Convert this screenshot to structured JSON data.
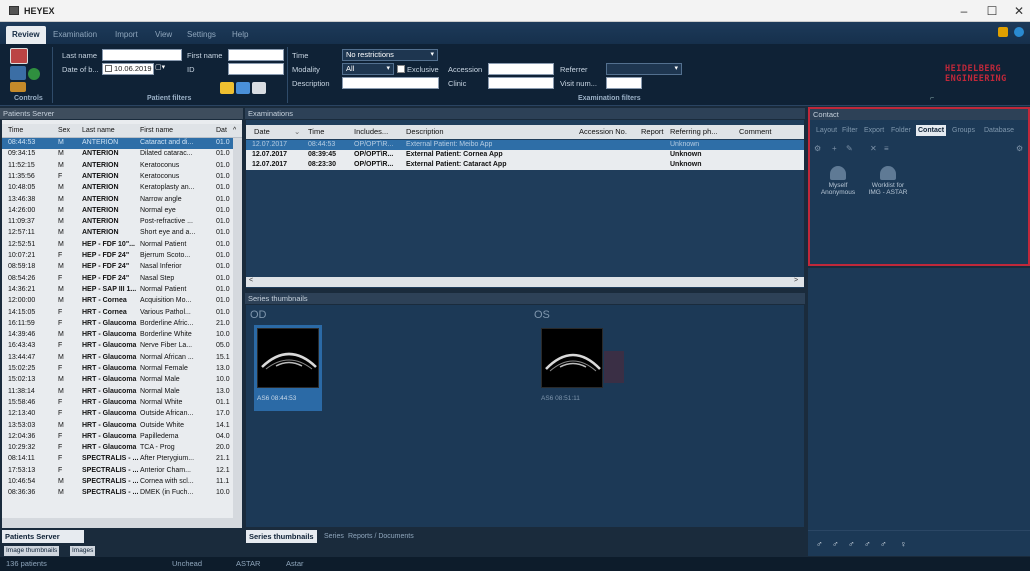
{
  "app": {
    "title": "HEYEX",
    "logo_line1": "HEIDELBERG",
    "logo_line2": "ENGINEERING",
    "status_patients": "136 patients",
    "status_user1": "Unchead",
    "status_user2": "ASTAR",
    "status_user3": "Astar"
  },
  "menu": [
    "Review",
    "Examination",
    "Import",
    "View",
    "Settings",
    "Help"
  ],
  "ribbon": {
    "controls_caption": "Controls",
    "last_name_label": "Last name",
    "first_name_label": "First name",
    "dob_label": "Date of b...",
    "dob_value": "10.06.2019",
    "id_label": "ID",
    "patient_filters_caption": "Patient filters",
    "time_label": "Time",
    "time_value": "No restrictions",
    "modality_label": "Modality",
    "modality_value": "All",
    "exclusive_label": "Exclusive",
    "description_label": "Description",
    "accession_label": "Accession",
    "clinic_label": "Clinic",
    "referrer_label": "Referrer",
    "visit_label": "Visit num...",
    "exam_filters_caption": "Examination filters"
  },
  "patients": {
    "panel_title": "Patients Server",
    "columns": [
      "Time",
      "Sex",
      "Last name",
      "First name",
      "Dat"
    ],
    "rows": [
      [
        "08:44:53",
        "M",
        "ANTERION",
        "Cataract and di...",
        "01.0"
      ],
      [
        "09:34:15",
        "M",
        "ANTERION",
        "Dilated catarac...",
        "01.0"
      ],
      [
        "11:52:15",
        "M",
        "ANTERION",
        "Keratoconus",
        "01.0"
      ],
      [
        "11:35:56",
        "F",
        "ANTERION",
        "Keratoconus",
        "01.0"
      ],
      [
        "10:48:05",
        "M",
        "ANTERION",
        "Keratoplasty an...",
        "01.0"
      ],
      [
        "13:46:38",
        "M",
        "ANTERION",
        "Narrow angle",
        "01.0"
      ],
      [
        "14:26:00",
        "M",
        "ANTERION",
        "Normal eye",
        "01.0"
      ],
      [
        "11:09:37",
        "M",
        "ANTERION",
        "Post-refractive ...",
        "01.0"
      ],
      [
        "12:57:11",
        "M",
        "ANTERION",
        "Short eye and a...",
        "01.0"
      ],
      [
        "12:52:51",
        "M",
        "HEP - FDF 10\"...",
        "Normal Patient",
        "01.0"
      ],
      [
        "10:07:21",
        "F",
        "HEP - FDF 24\"",
        "Bjerrum Scoto...",
        "01.0"
      ],
      [
        "08:59:18",
        "M",
        "HEP - FDF 24\"",
        "Nasal Inferior",
        "01.0"
      ],
      [
        "08:54:26",
        "F",
        "HEP - FDF 24\"",
        "Nasal Step",
        "01.0"
      ],
      [
        "14:36:21",
        "M",
        "HEP - SAP III 1...",
        "Normal Patient",
        "01.0"
      ],
      [
        "12:00:00",
        "M",
        "HRT - Cornea",
        "Acquisition Mo...",
        "01.0"
      ],
      [
        "14:15:05",
        "F",
        "HRT - Cornea",
        "Various Pathol...",
        "01.0"
      ],
      [
        "16:11:59",
        "F",
        "HRT - Glaucoma",
        "Borderline Afric...",
        "21.0"
      ],
      [
        "14:39:46",
        "M",
        "HRT - Glaucoma",
        "Borderline White",
        "10.0"
      ],
      [
        "16:43:43",
        "F",
        "HRT - Glaucoma",
        "Nerve Fiber La...",
        "05.0"
      ],
      [
        "13:44:47",
        "M",
        "HRT - Glaucoma",
        "Normal African ...",
        "15.1"
      ],
      [
        "15:02:25",
        "F",
        "HRT - Glaucoma",
        "Normal Female",
        "13.0"
      ],
      [
        "15:02:13",
        "M",
        "HRT - Glaucoma",
        "Normal Male",
        "10.0"
      ],
      [
        "11:38:14",
        "M",
        "HRT - Glaucoma",
        "Normal Male",
        "13.0"
      ],
      [
        "15:58:46",
        "F",
        "HRT - Glaucoma",
        "Normal White",
        "01.1"
      ],
      [
        "12:13:40",
        "F",
        "HRT - Glaucoma",
        "Outside African...",
        "17.0"
      ],
      [
        "13:53:03",
        "M",
        "HRT - Glaucoma",
        "Outside White",
        "14.1"
      ],
      [
        "12:04:36",
        "F",
        "HRT - Glaucoma",
        "Papilledema",
        "04.0"
      ],
      [
        "10:29:32",
        "F",
        "HRT - Glaucoma",
        "TCA - Prog",
        "20.0"
      ],
      [
        "08:14:11",
        "F",
        "SPECTRALIS - ...",
        "After Pterygium...",
        "21.1"
      ],
      [
        "17:53:13",
        "F",
        "SPECTRALIS - ...",
        "Anterior Cham...",
        "12.1"
      ],
      [
        "10:46:54",
        "M",
        "SPECTRALIS - ...",
        "Cornea with scl...",
        "11.1"
      ],
      [
        "08:36:36",
        "M",
        "SPECTRALIS - ...",
        "DMEK (in Fuch...",
        "10.0"
      ]
    ],
    "bottom_tab": "Patients Server",
    "bottom_tabs2": [
      "Image thumbnails",
      "Images"
    ]
  },
  "examinations": {
    "panel_title": "Examinations",
    "columns": [
      "Date",
      "Time",
      "Includes...",
      "Description",
      "Accession No.",
      "Report",
      "Referring ph...",
      "Comment"
    ],
    "rows": [
      [
        "12.07.2017",
        "08:44:53",
        "OP/OPT\\R...",
        "External Patient: Meibo App",
        "",
        "",
        "Unknown",
        ""
      ],
      [
        "12.07.2017",
        "08:39:45",
        "OP/OPT\\R...",
        "External Patient: Cornea App",
        "",
        "",
        "Unknown",
        ""
      ],
      [
        "12.07.2017",
        "08:23:30",
        "OP/OPT\\R...",
        "External Patient: Cataract App",
        "",
        "",
        "Unknown",
        ""
      ]
    ]
  },
  "series": {
    "panel_title": "Series thumbnails",
    "od_label": "OD",
    "os_label": "OS",
    "od_caption": "AS6 08:44:53",
    "os_caption": "AS6 08:51:11",
    "tabs": [
      "Series thumbnails",
      "Series",
      "Reports / Documents"
    ]
  },
  "contact": {
    "panel_title": "Contact",
    "tabs": [
      "Layout",
      "Filter",
      "Export",
      "Folder",
      "Contact",
      "Groups",
      "Database"
    ],
    "item1_line1": "Myself",
    "item1_line2": "Anonymous",
    "item2_line1": "Worklist for",
    "item2_line2": "IMG - ASTAR"
  },
  "colors": {
    "accent_red": "#c0283a",
    "selection": "#2e6ea7",
    "panel_bg": "#1e3a55"
  }
}
